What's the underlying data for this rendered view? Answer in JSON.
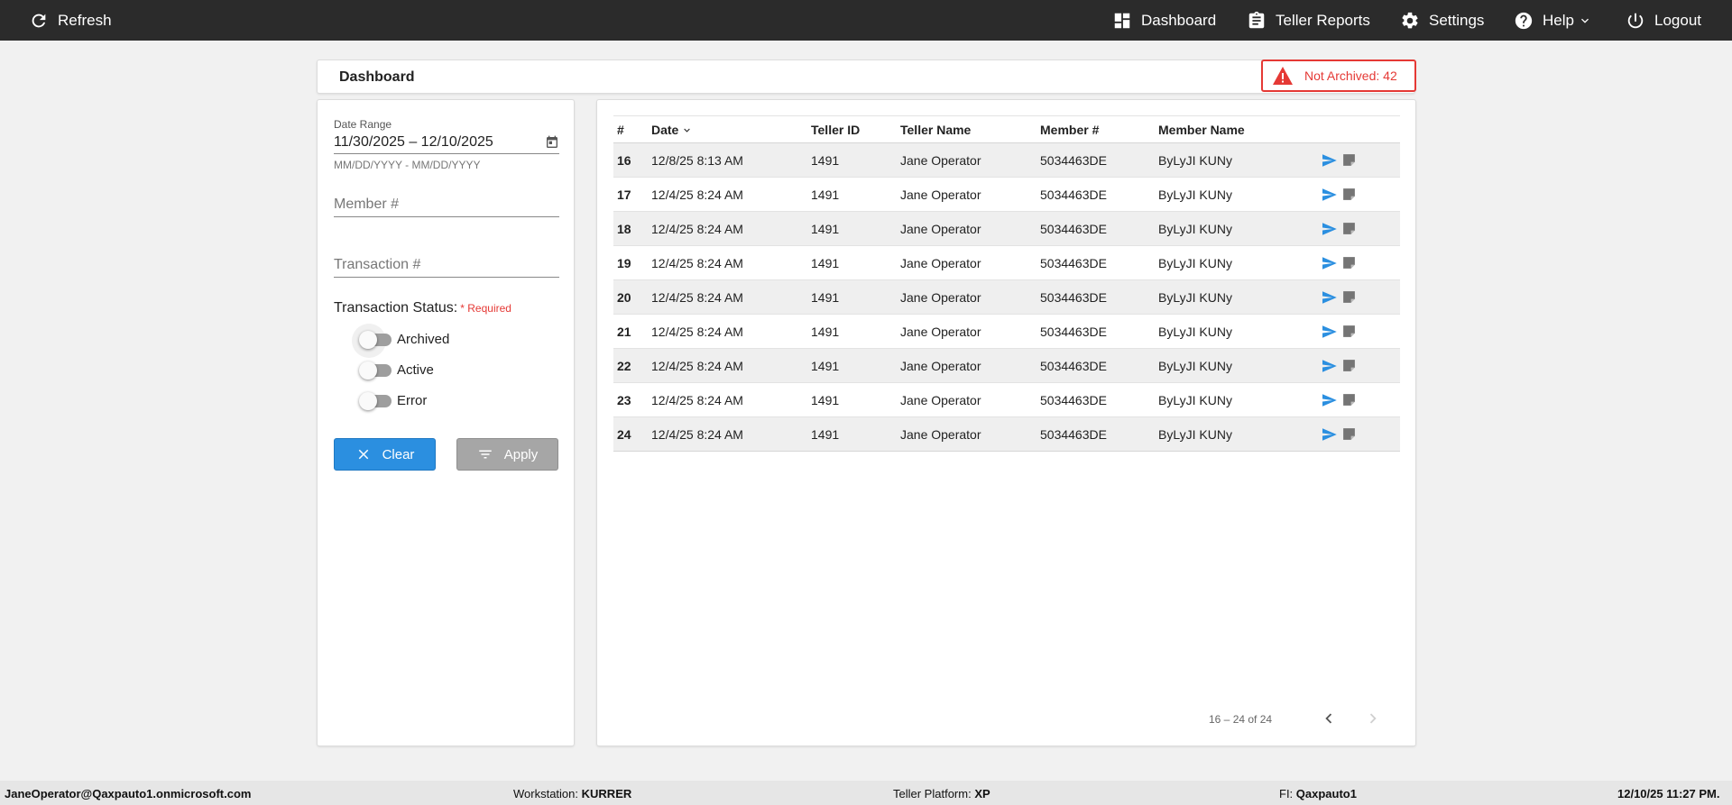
{
  "nav": {
    "refresh": "Refresh",
    "dashboard": "Dashboard",
    "teller_reports": "Teller Reports",
    "settings": "Settings",
    "help": "Help",
    "logout": "Logout"
  },
  "header": {
    "title": "Dashboard",
    "alert": "Not Archived: 42"
  },
  "filters": {
    "date_range_label": "Date Range",
    "date_range_value": "11/30/2025 – 12/10/2025",
    "date_range_hint": "MM/DD/YYYY - MM/DD/YYYY",
    "member_placeholder": "Member #",
    "member_value": "",
    "transaction_placeholder": "Transaction #",
    "transaction_value": "",
    "status_label": "Transaction Status:",
    "required_label": "* Required",
    "statuses": [
      {
        "label": "Archived",
        "on": false
      },
      {
        "label": "Active",
        "on": false
      },
      {
        "label": "Error",
        "on": false
      }
    ],
    "clear_label": "Clear",
    "apply_label": "Apply"
  },
  "table": {
    "columns": [
      "#",
      "Date",
      "Teller ID",
      "Teller Name",
      "Member #",
      "Member Name"
    ],
    "rows": [
      {
        "num": "16",
        "date": "12/8/25 8:13 AM",
        "teller_id": "1491",
        "teller_name": "Jane Operator",
        "member": "5034463DE",
        "member_name": "ByLyJI KUNy"
      },
      {
        "num": "17",
        "date": "12/4/25 8:24 AM",
        "teller_id": "1491",
        "teller_name": "Jane Operator",
        "member": "5034463DE",
        "member_name": "ByLyJI KUNy"
      },
      {
        "num": "18",
        "date": "12/4/25 8:24 AM",
        "teller_id": "1491",
        "teller_name": "Jane Operator",
        "member": "5034463DE",
        "member_name": "ByLyJI KUNy"
      },
      {
        "num": "19",
        "date": "12/4/25 8:24 AM",
        "teller_id": "1491",
        "teller_name": "Jane Operator",
        "member": "5034463DE",
        "member_name": "ByLyJI KUNy"
      },
      {
        "num": "20",
        "date": "12/4/25 8:24 AM",
        "teller_id": "1491",
        "teller_name": "Jane Operator",
        "member": "5034463DE",
        "member_name": "ByLyJI KUNy"
      },
      {
        "num": "21",
        "date": "12/4/25 8:24 AM",
        "teller_id": "1491",
        "teller_name": "Jane Operator",
        "member": "5034463DE",
        "member_name": "ByLyJI KUNy"
      },
      {
        "num": "22",
        "date": "12/4/25 8:24 AM",
        "teller_id": "1491",
        "teller_name": "Jane Operator",
        "member": "5034463DE",
        "member_name": "ByLyJI KUNy"
      },
      {
        "num": "23",
        "date": "12/4/25 8:24 AM",
        "teller_id": "1491",
        "teller_name": "Jane Operator",
        "member": "5034463DE",
        "member_name": "ByLyJI KUNy"
      },
      {
        "num": "24",
        "date": "12/4/25 8:24 AM",
        "teller_id": "1491",
        "teller_name": "Jane Operator",
        "member": "5034463DE",
        "member_name": "ByLyJI KUNy"
      }
    ],
    "row_icons": [
      "send-icon",
      "note-icon"
    ]
  },
  "pagination": {
    "range": "16 – 24 of 24"
  },
  "footer": {
    "user": "JaneOperator@Qaxpauto1.onmicrosoft.com",
    "workstation_label": "Workstation:",
    "workstation": "KURRER",
    "platform_label": "Teller Platform:",
    "platform": "XP",
    "fi_label": "FI:",
    "fi": "Qaxpauto1",
    "datetime": "12/10/25 11:27 PM."
  },
  "colors": {
    "topbar": "#2b2b2b",
    "accent_blue": "#2b8fe0",
    "alert_red": "#e53935",
    "row_stripe": "#efefef"
  }
}
